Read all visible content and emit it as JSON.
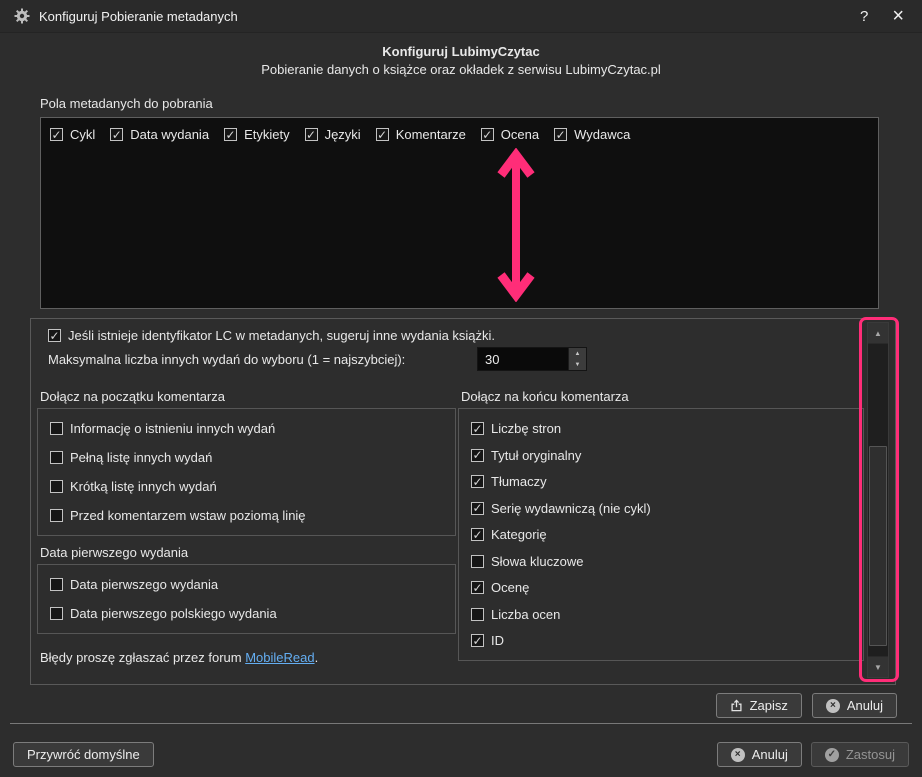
{
  "colors": {
    "annotation_pink": "#ff2d78",
    "link_blue": "#64aef2",
    "dialog_bg": "#2d2d2d",
    "list_bg": "#0f0f0f"
  },
  "titlebar": {
    "title": "Konfiguruj Pobieranie metadanych",
    "help": "?",
    "close": "×"
  },
  "header": {
    "title": "Konfiguruj LubimyCzytac",
    "subtitle": "Pobieranie danych o książce oraz okładek z serwisu LubimyCzytac.pl"
  },
  "fields_label": "Pola metadanych do pobrania",
  "field_checkboxes": [
    {
      "label": "Cykl",
      "checked": true
    },
    {
      "label": "Data wydania",
      "checked": true
    },
    {
      "label": "Etykiety",
      "checked": true
    },
    {
      "label": "Języki",
      "checked": true
    },
    {
      "label": "Komentarze",
      "checked": true
    },
    {
      "label": "Ocena",
      "checked": true
    },
    {
      "label": "Wydawca",
      "checked": true
    }
  ],
  "suggest_checkbox": {
    "label": "Jeśli istnieje identyfikator LC w metadanych, sugeruj inne wydania książki.",
    "checked": true
  },
  "max_editions": {
    "label": "Maksymalna liczba innych wydań do wyboru (1 = najszybciej):",
    "value": "30"
  },
  "group_begin": {
    "title": "Dołącz na początku komentarza",
    "items": [
      {
        "label": "Informację o istnieniu innych wydań",
        "checked": false
      },
      {
        "label": "Pełną listę innych wydań",
        "checked": false
      },
      {
        "label": "Krótką listę innych wydań",
        "checked": false
      },
      {
        "label": "Przed komentarzem wstaw poziomą linię",
        "checked": false
      }
    ]
  },
  "group_first_date": {
    "title": "Data pierwszego wydania",
    "items": [
      {
        "label": "Data pierwszego wydania",
        "checked": false
      },
      {
        "label": "Data pierwszego polskiego wydania",
        "checked": false
      }
    ]
  },
  "group_end": {
    "title": "Dołącz na końcu komentarza",
    "items": [
      {
        "label": "Liczbę stron",
        "checked": true
      },
      {
        "label": "Tytuł oryginalny",
        "checked": true
      },
      {
        "label": "Tłumaczy",
        "checked": true
      },
      {
        "label": "Serię wydawniczą (nie cykl)",
        "checked": true
      },
      {
        "label": "Kategorię",
        "checked": true
      },
      {
        "label": "Słowa kluczowe",
        "checked": false
      },
      {
        "label": "Ocenę",
        "checked": true
      },
      {
        "label": "Liczba ocen",
        "checked": false
      },
      {
        "label": "ID",
        "checked": true
      }
    ]
  },
  "report": {
    "text_before": "Błędy proszę zgłaszać przez forum ",
    "link": "MobileRead",
    "text_after": "."
  },
  "buttons": {
    "save": "Zapisz",
    "cancel_top": "Anuluj",
    "restore_defaults": "Przywróć domyślne",
    "cancel_bottom": "Anuluj",
    "apply": "Zastosuj"
  },
  "icon_glyphs": {
    "cancel_circle": "×",
    "apply_circle": "✓",
    "spin_up": "▲",
    "spin_down": "▼",
    "scroll_up": "▲",
    "scroll_down": "▼"
  }
}
